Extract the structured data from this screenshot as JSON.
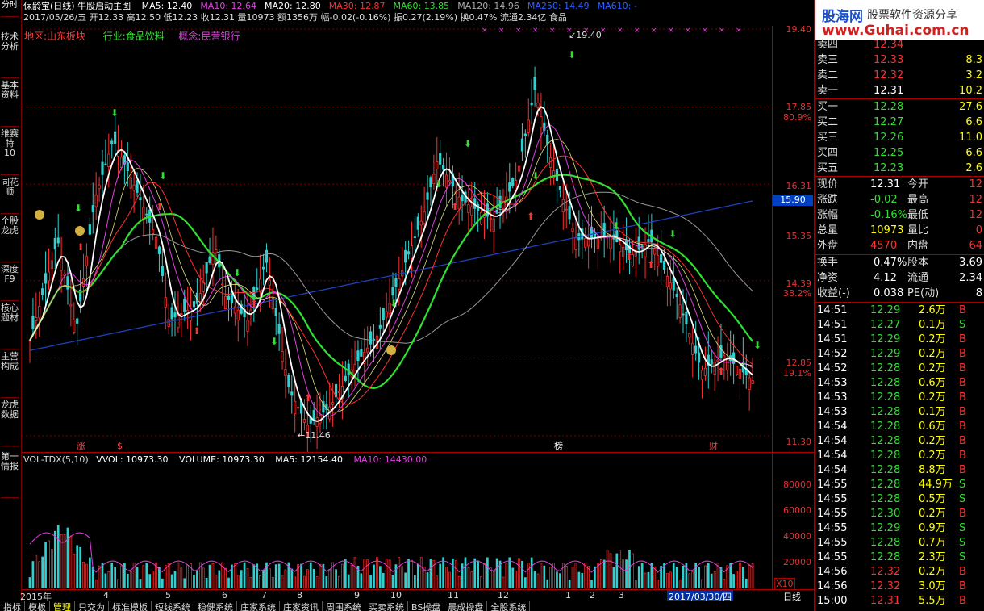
{
  "rail": [
    "技术分析",
    "基本资料",
    "维赛特10",
    "同花顺",
    "个股龙虎",
    "深度F9",
    "核心题材",
    "主营构成",
    "龙虎数据",
    "第一情报"
  ],
  "header": {
    "title": "保龄宝(日线) 牛股启动主图",
    "ma": [
      {
        "label": "MA5: 12.40",
        "color": "#ffffff"
      },
      {
        "label": "MA10: 12.64",
        "color": "#e040e0"
      },
      {
        "label": "MA20: 12.80",
        "color": "#ffffff"
      },
      {
        "label": "MA30: 12.87",
        "color": "#ff3030"
      },
      {
        "label": "MA60: 13.85",
        "color": "#30e030"
      },
      {
        "label": "MA120: 14.96",
        "color": "#aaaaaa"
      },
      {
        "label": "MA250: 14.49",
        "color": "#3060ff"
      },
      {
        "label": "MA610: -",
        "color": "#3060ff"
      }
    ],
    "quote_line": "2017/05/26/五 开12.33 高12.50 低12.23 收12.31 量10973 额1356万 幅-0.02(-0.16%) 振0.27(2.19%) 换0.47% 流通2.34亿 食品",
    "tags": {
      "region": "地区:山东板块",
      "industry": "行业:食品饮料",
      "concept": "概念:民营银行"
    }
  },
  "price_axis": [
    "19.40",
    "17.85",
    "80.9%",
    "16.31",
    "15.90",
    "15.35",
    "14.39",
    "38.2%",
    "12.85",
    "19.1%",
    "11.30"
  ],
  "annotations": {
    "high": "19.40",
    "low": "11.46",
    "markers": [
      "涨",
      "$",
      "榜",
      "财"
    ]
  },
  "vol": {
    "title": "VOL-TDX(5,10)",
    "vvol": "VVOL: 10973.30",
    "volume": "VOLUME: 10973.30",
    "ma5": "MA5: 12154.40",
    "ma10": "MA10: 14430.00",
    "axis": [
      "80000",
      "60000",
      "40000",
      "20000",
      "X10"
    ]
  },
  "dates": [
    "2015年",
    "4",
    "5",
    "6",
    "7",
    "8",
    "9",
    "10",
    "11",
    "12",
    "1",
    "2",
    "3",
    "2017/03/30/四"
  ],
  "period": "日线",
  "tabs": [
    "指标",
    "模板",
    "管理",
    "只交为",
    "标准模板",
    "短线系统",
    "稳健系统",
    "庄家系统",
    "庄家资讯",
    "周围系统",
    "买卖系统",
    "BS操盘",
    "晨成操盘",
    "全股系统"
  ],
  "right": {
    "logo_cn": "股海网",
    "logo_right": "股票软件资源分享",
    "logo_url": "www.Guhai.com.cn",
    "asks": [
      {
        "label": "卖四",
        "price": "12.34",
        "vol": ""
      },
      {
        "label": "卖三",
        "price": "12.33",
        "vol": "8.3"
      },
      {
        "label": "卖二",
        "price": "12.32",
        "vol": "3.2"
      },
      {
        "label": "卖一",
        "price": "12.31",
        "vol": "10.2"
      }
    ],
    "bids": [
      {
        "label": "买一",
        "price": "12.28",
        "vol": "27.6"
      },
      {
        "label": "买二",
        "price": "12.27",
        "vol": "6.6"
      },
      {
        "label": "买三",
        "price": "12.26",
        "vol": "11.0"
      },
      {
        "label": "买四",
        "price": "12.25",
        "vol": "6.6"
      },
      {
        "label": "买五",
        "price": "12.23",
        "vol": "2.6"
      }
    ],
    "stats": [
      {
        "k1": "现价",
        "v1": "12.31",
        "k2": "今开",
        "v2": "12",
        "c": "#ffffff"
      },
      {
        "k1": "涨跌",
        "v1": "-0.02",
        "k2": "最高",
        "v2": "12",
        "c": "#30e030"
      },
      {
        "k1": "涨幅",
        "v1": "-0.16%",
        "k2": "最低",
        "v2": "12",
        "c": "#30e030"
      },
      {
        "k1": "总量",
        "v1": "10973",
        "k2": "量比",
        "v2": "0",
        "c": "#ffff00"
      },
      {
        "k1": "外盘",
        "v1": "4570",
        "k2": "内盘",
        "v2": "64",
        "c": "#ff3030"
      }
    ],
    "stats2": [
      {
        "k1": "换手",
        "v1": "0.47%",
        "k2": "股本",
        "v2": "3.69"
      },
      {
        "k1": "净资",
        "v1": "4.12",
        "k2": "流通",
        "v2": "2.34"
      },
      {
        "k1": "收益(-)",
        "v1": "0.038",
        "k2": "PE(动)",
        "v2": "8"
      }
    ],
    "ticks": [
      {
        "t": "14:51",
        "p": "12.29",
        "v": "2.6万",
        "s": "B"
      },
      {
        "t": "14:51",
        "p": "12.27",
        "v": "0.1万",
        "s": "S"
      },
      {
        "t": "14:51",
        "p": "12.29",
        "v": "0.2万",
        "s": "B"
      },
      {
        "t": "14:52",
        "p": "12.29",
        "v": "0.2万",
        "s": "B"
      },
      {
        "t": "14:52",
        "p": "12.28",
        "v": "0.2万",
        "s": "B"
      },
      {
        "t": "14:53",
        "p": "12.28",
        "v": "0.6万",
        "s": "B"
      },
      {
        "t": "14:53",
        "p": "12.28",
        "v": "0.2万",
        "s": "B"
      },
      {
        "t": "14:53",
        "p": "12.28",
        "v": "0.1万",
        "s": "B"
      },
      {
        "t": "14:54",
        "p": "12.28",
        "v": "0.6万",
        "s": "B"
      },
      {
        "t": "14:54",
        "p": "12.28",
        "v": "0.2万",
        "s": "B"
      },
      {
        "t": "14:54",
        "p": "12.28",
        "v": "0.2万",
        "s": "B"
      },
      {
        "t": "14:54",
        "p": "12.28",
        "v": "8.8万",
        "s": "B"
      },
      {
        "t": "14:55",
        "p": "12.28",
        "v": "44.9万",
        "s": "S"
      },
      {
        "t": "14:55",
        "p": "12.28",
        "v": "0.5万",
        "s": "S"
      },
      {
        "t": "14:55",
        "p": "12.30",
        "v": "0.2万",
        "s": "B"
      },
      {
        "t": "14:55",
        "p": "12.29",
        "v": "0.9万",
        "s": "S"
      },
      {
        "t": "14:55",
        "p": "12.28",
        "v": "0.7万",
        "s": "S"
      },
      {
        "t": "14:55",
        "p": "12.28",
        "v": "2.3万",
        "s": "S"
      },
      {
        "t": "14:56",
        "p": "12.32",
        "v": "0.2万",
        "s": "B"
      },
      {
        "t": "14:56",
        "p": "12.32",
        "v": "3.0万",
        "s": "B"
      },
      {
        "t": "15:00",
        "p": "12.31",
        "v": "5.5万",
        "s": "B"
      }
    ]
  }
}
